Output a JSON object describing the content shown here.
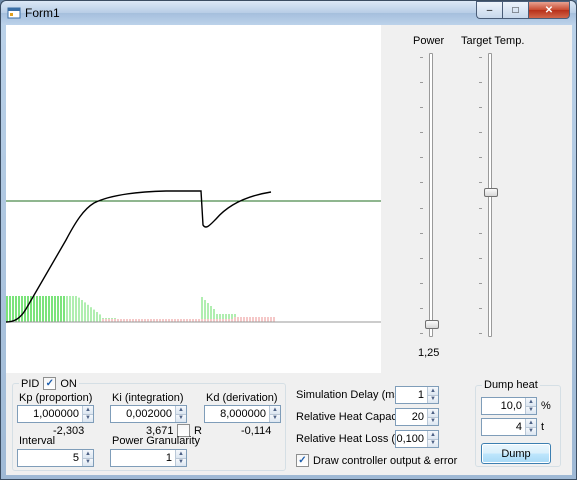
{
  "window": {
    "title": "Form1"
  },
  "caption_buttons": {
    "minimize": "–",
    "maximize": "□",
    "close": "✕"
  },
  "sliders": {
    "power": {
      "label": "Power",
      "value_text": "1,25",
      "position_fraction": 0.03
    },
    "target_temp": {
      "label": "Target Temp.",
      "position_fraction": 0.51
    }
  },
  "pid": {
    "label": "PID",
    "on_label": "ON",
    "on_checked": true,
    "kp": {
      "label": "Kp (proportion)",
      "value": "1,000000",
      "readout": "-2,303"
    },
    "ki": {
      "label": "Ki (integration)",
      "value": "0,002000",
      "readout": "3,671",
      "r_label": "R",
      "r_checked": false
    },
    "kd": {
      "label": "Kd (derivation)",
      "value": "8,000000",
      "readout": "-0,114"
    },
    "interval": {
      "label": "Interval",
      "value": "5"
    },
    "power_granularity": {
      "label": "Power Granularity",
      "value": "1"
    }
  },
  "simulation": {
    "delay": {
      "label": "Simulation Delay (ms)",
      "value": "1"
    },
    "heat_capacity": {
      "label": "Relative Heat Capacity",
      "value": "20"
    },
    "heat_loss": {
      "label": "Relative Heat Loss (%)",
      "value": "0,100"
    },
    "draw_output": {
      "label": "Draw controller output & error",
      "checked": true
    }
  },
  "dump_heat": {
    "title": "Dump heat",
    "percent_value": "10,0",
    "percent_unit": "%",
    "t_value": "4",
    "t_unit": "t",
    "button_label": "Dump"
  },
  "colors": {
    "temperature_curve": "#000000",
    "setpoint_line": "#1f6e1f",
    "output_bars": "#7be37b",
    "error_bars": "#f5c8c8"
  }
}
